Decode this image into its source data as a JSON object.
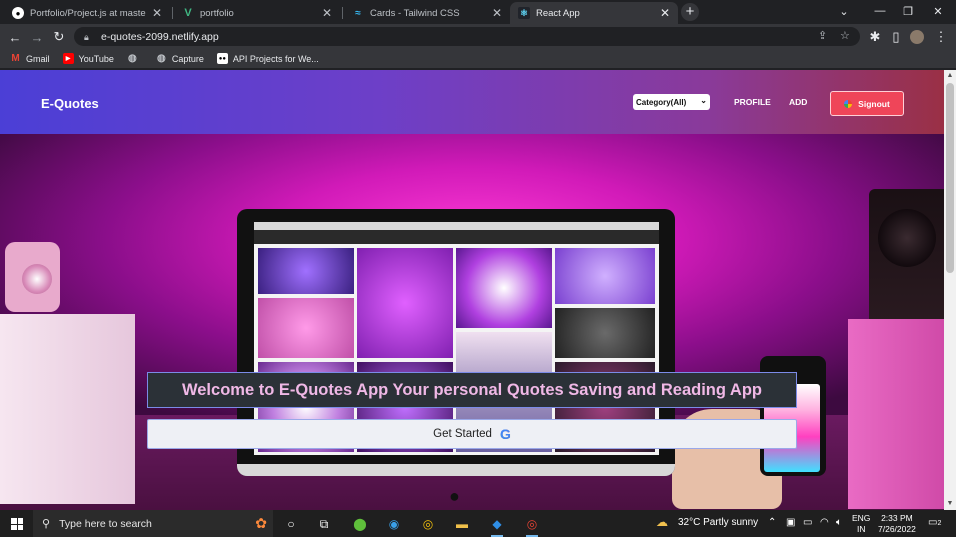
{
  "browser": {
    "tabs": [
      {
        "title": "Portfolio/Project.js at master · SU",
        "icon": "github-icon",
        "active": false
      },
      {
        "title": "portfolio",
        "icon": "vue-icon",
        "active": false
      },
      {
        "title": "Cards - Tailwind CSS",
        "icon": "tailwind-icon",
        "active": false
      },
      {
        "title": "React App",
        "icon": "react-icon",
        "active": true
      }
    ],
    "url": "e-quotes-2099.netlify.app",
    "bookmarks": [
      {
        "label": "Gmail",
        "icon": "gmail-icon"
      },
      {
        "label": "YouTube",
        "icon": "youtube-icon"
      },
      {
        "label": "",
        "icon": "globe-icon"
      },
      {
        "label": "Capture",
        "icon": "globe-icon"
      },
      {
        "label": "API Projects for We...",
        "icon": "dev-icon"
      }
    ]
  },
  "app": {
    "brand": "E-Quotes",
    "category_select": {
      "selected": "Category(All)"
    },
    "nav": {
      "profile": "PROFILE",
      "add": "ADD",
      "signout": "Signout"
    },
    "hero": {
      "welcome": "Welcome to E-Quotes App Your personal Quotes Saving and Reading App",
      "get_started": "Get Started",
      "get_started_icon": "G"
    }
  },
  "taskbar": {
    "search_placeholder": "Type here to search",
    "weather": "32°C  Partly sunny",
    "language": [
      "ENG",
      "IN"
    ],
    "time": "2:33 PM",
    "date": "7/26/2022",
    "notification_count": "2"
  },
  "colors": {
    "navbar_start": "#4b3fd6",
    "navbar_end": "#9a3045",
    "signout": "#ef4559",
    "welcome_bg": "#2b3137",
    "welcome_text": "#f0b8e6",
    "scroll_top": "#7c3aed"
  }
}
